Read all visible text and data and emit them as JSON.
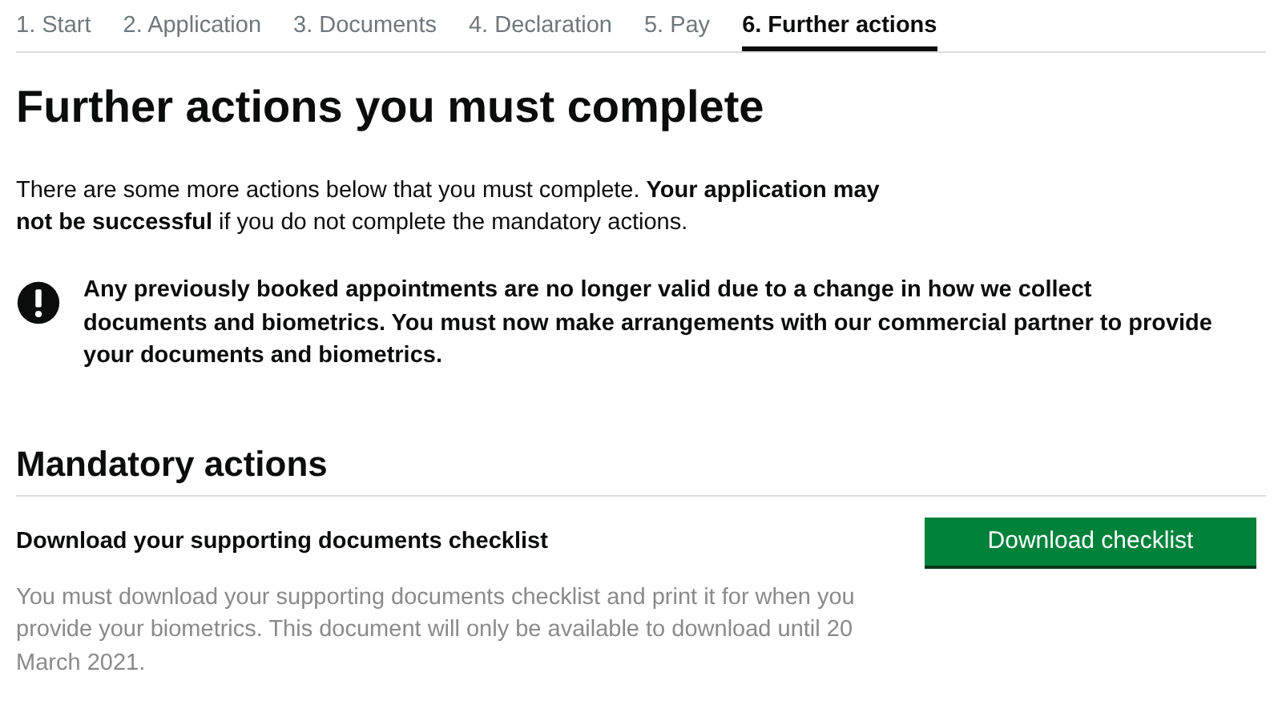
{
  "steps": [
    {
      "label": "1. Start",
      "selected": false
    },
    {
      "label": "2. Application",
      "selected": false
    },
    {
      "label": "3. Documents",
      "selected": false
    },
    {
      "label": "4. Declaration",
      "selected": false
    },
    {
      "label": "5. Pay",
      "selected": false
    },
    {
      "label": "6. Further actions",
      "selected": true
    }
  ],
  "heading": "Further actions you must complete",
  "intro": "There are some more actions below that you must complete. **Your application may not be successful** if you do not complete the mandatory actions.",
  "warning": "Any previously booked appointments are no longer valid due to a change in how we collect documents and biometrics. You must now make arrangements with our commercial partner to provide your documents and biometrics.",
  "section": {
    "title": "Mandatory actions",
    "actions": [
      {
        "title": "Download your supporting documents checklist",
        "button": "Download checklist",
        "description": "You must download your supporting documents checklist and print it for when you provide your biometrics. This document will only be available to download until 20 March 2021."
      }
    ]
  }
}
